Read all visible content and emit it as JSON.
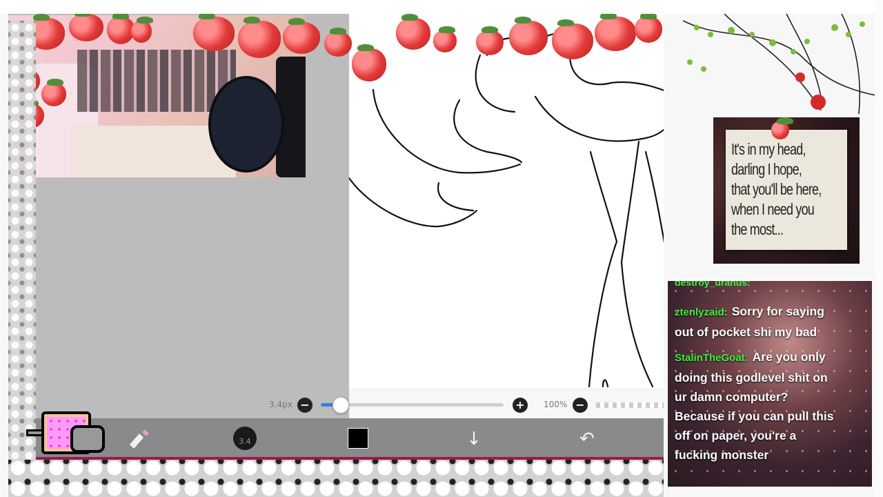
{
  "quote": {
    "lines": [
      "It's in my head,",
      "darling I hope,",
      "that you'll be here,",
      "when I need you",
      "the most..."
    ]
  },
  "chat": {
    "partial_top": "destroy_uranus:",
    "messages": [
      {
        "user": "ztenlyzaid:",
        "lines": [
          "Sorry for saying",
          "out of pocket shi my bad"
        ]
      },
      {
        "user": "StalinTheGoat:",
        "lines": [
          "Are you only",
          "doing this godlevel shit on",
          "ur damn computer?",
          "Because if you can pull this",
          "off on paper, you're a",
          "fucking monster"
        ]
      }
    ]
  },
  "brush": {
    "size_label": "3.4px",
    "size_fraction": 0.11,
    "opacity_label": "100%",
    "minus": "−",
    "plus": "+"
  },
  "toolbar": {
    "brush_size_badge": "3.4",
    "download_glyph": "↓",
    "undo_glyph": "↶",
    "color_swatch": "#000000"
  },
  "colors": {
    "toolbar_bg": "#888a8c",
    "taskbar_bg": "#9b1549",
    "chat_username": "#3cf03c",
    "slider_fill": "#3b7ee0"
  },
  "icons": [
    "nyan-cat",
    "brush-tool-icon",
    "color-swatch-icon",
    "download-icon",
    "undo-icon",
    "strawberry-decoration",
    "vine-decoration"
  ]
}
